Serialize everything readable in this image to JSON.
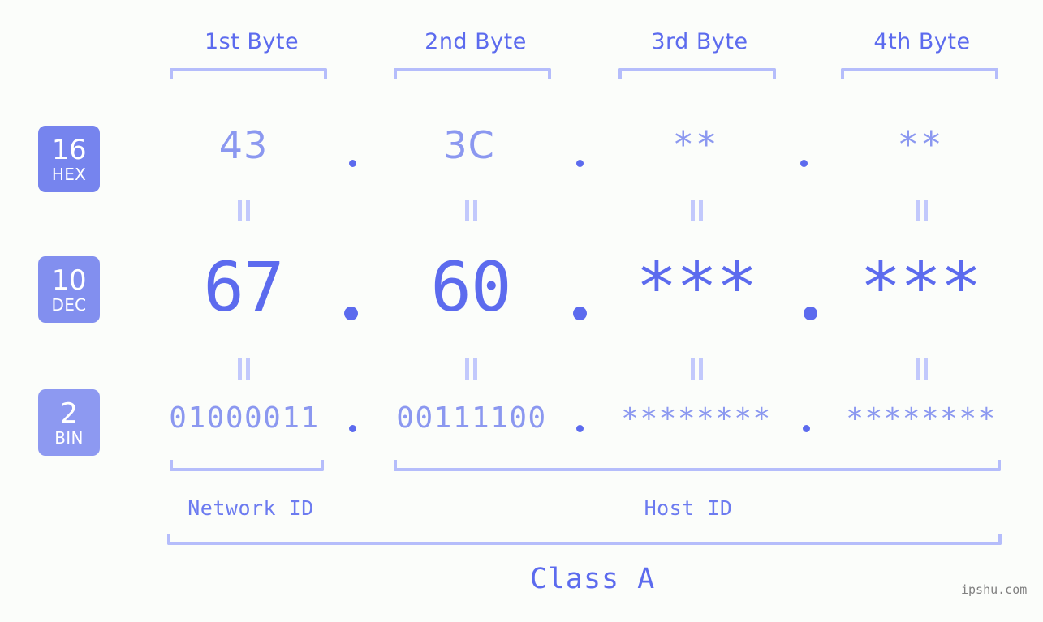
{
  "meta": {
    "watermark": "ipshu.com",
    "accent": "#5c6bee",
    "accent_light": "#8b98f0",
    "bracket_color": "#b5bdfb",
    "background": "#fbfdfa"
  },
  "byte_headers": [
    {
      "label": "1st Byte"
    },
    {
      "label": "2nd Byte"
    },
    {
      "label": "3rd Byte"
    },
    {
      "label": "4th Byte"
    }
  ],
  "rows": [
    {
      "id": "hex",
      "badge_number": "16",
      "badge_abbr": "HEX",
      "badge_color": "#7684ee",
      "values": [
        "43",
        "3C",
        "**",
        "**"
      ],
      "separator": "."
    },
    {
      "id": "dec",
      "badge_number": "10",
      "badge_abbr": "DEC",
      "badge_color": "#828fef",
      "values": [
        "67",
        "60",
        "***",
        "***"
      ],
      "separator": "."
    },
    {
      "id": "bin",
      "badge_number": "2",
      "badge_abbr": "BIN",
      "badge_color": "#8d99f1",
      "values": [
        "01000011",
        "00111100",
        "********",
        "********"
      ],
      "separator": "."
    }
  ],
  "connector_symbol": "=",
  "sections": [
    {
      "label": "Network ID"
    },
    {
      "label": "Host ID"
    }
  ],
  "class": {
    "label": "Class A"
  }
}
